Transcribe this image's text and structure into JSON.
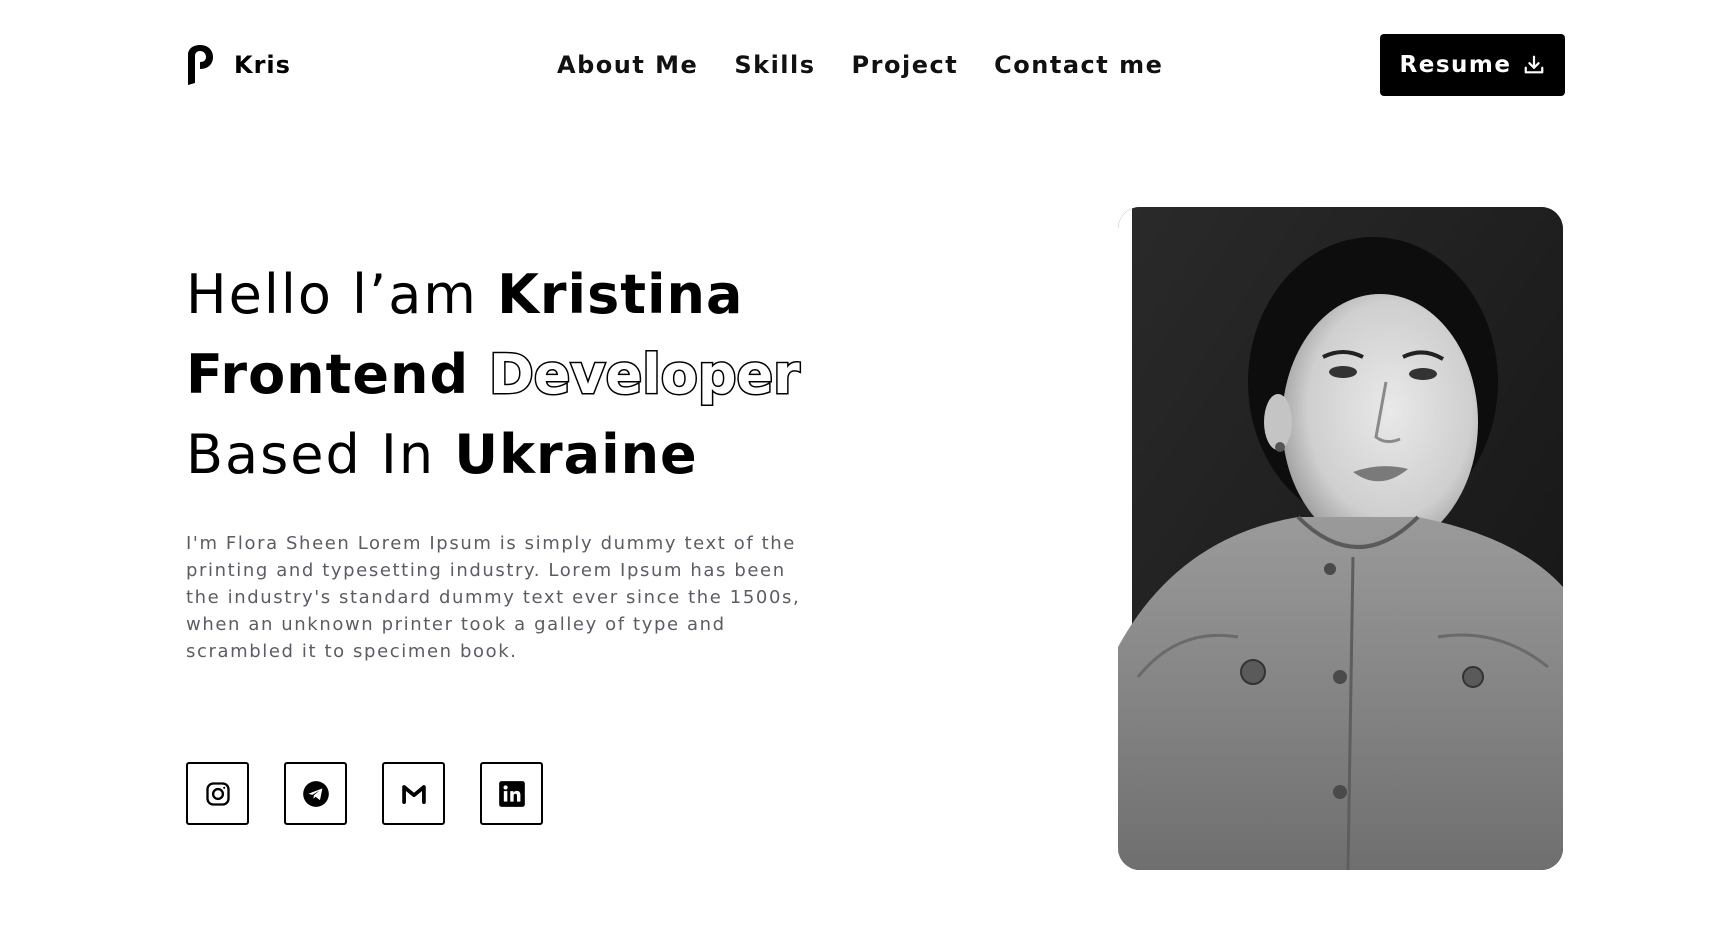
{
  "brand": {
    "name": "Kris",
    "logo_icon": "brand-logo-icon"
  },
  "nav": {
    "items": [
      {
        "label": "About Me"
      },
      {
        "label": "Skills"
      },
      {
        "label": "Project"
      },
      {
        "label": "Contact me"
      }
    ]
  },
  "header": {
    "resume_label": "Resume",
    "resume_icon": "download-icon"
  },
  "hero": {
    "line1_regular": "Hello l’am ",
    "line1_bold": "Kristina",
    "line2_bold": "Frontend ",
    "line2_outline": "Developer",
    "line3_regular": "Based In ",
    "line3_bold": "Ukraine",
    "description": "I'm Flora Sheen Lorem Ipsum is simply dummy text of the printing and typesetting industry. Lorem Ipsum has been the industry's standard dummy text ever since the 1500s, when an unknown printer took a galley of type and scrambled it to specimen book."
  },
  "socials": [
    {
      "icon": "instagram-icon"
    },
    {
      "icon": "telegram-icon"
    },
    {
      "icon": "gmail-icon"
    },
    {
      "icon": "linkedin-icon"
    }
  ],
  "colors": {
    "primary": "#000000",
    "background": "#ffffff",
    "description_text": "#5c5c66"
  }
}
